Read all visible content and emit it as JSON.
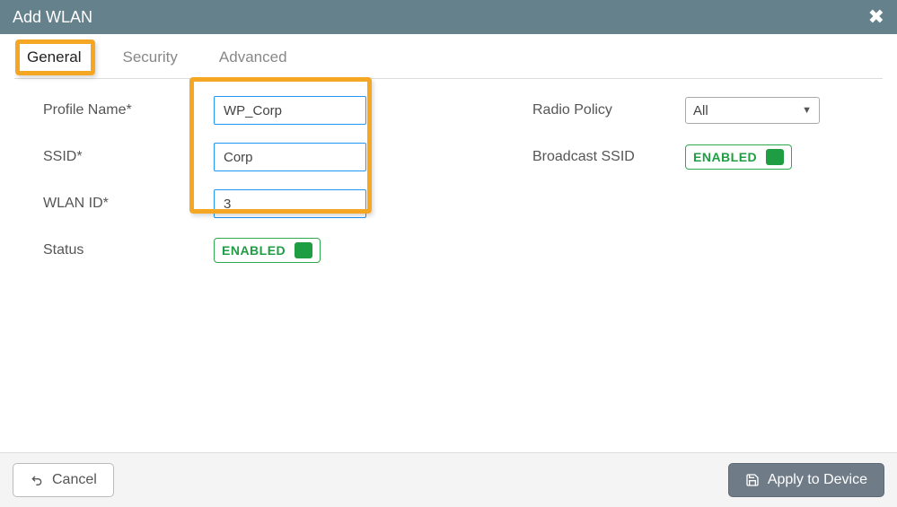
{
  "header": {
    "title": "Add WLAN"
  },
  "tabs": {
    "general": "General",
    "security": "Security",
    "advanced": "Advanced",
    "active": "general"
  },
  "labels": {
    "profile_name": "Profile Name*",
    "ssid": "SSID*",
    "wlan_id": "WLAN ID*",
    "status": "Status",
    "radio_policy": "Radio Policy",
    "broadcast_ssid": "Broadcast SSID"
  },
  "values": {
    "profile_name": "WP_Corp",
    "ssid": "Corp",
    "wlan_id": "3",
    "radio_policy_selected": "All"
  },
  "toggles": {
    "status_label": "ENABLED",
    "broadcast_label": "ENABLED"
  },
  "footer": {
    "cancel": "Cancel",
    "apply": "Apply to Device"
  }
}
